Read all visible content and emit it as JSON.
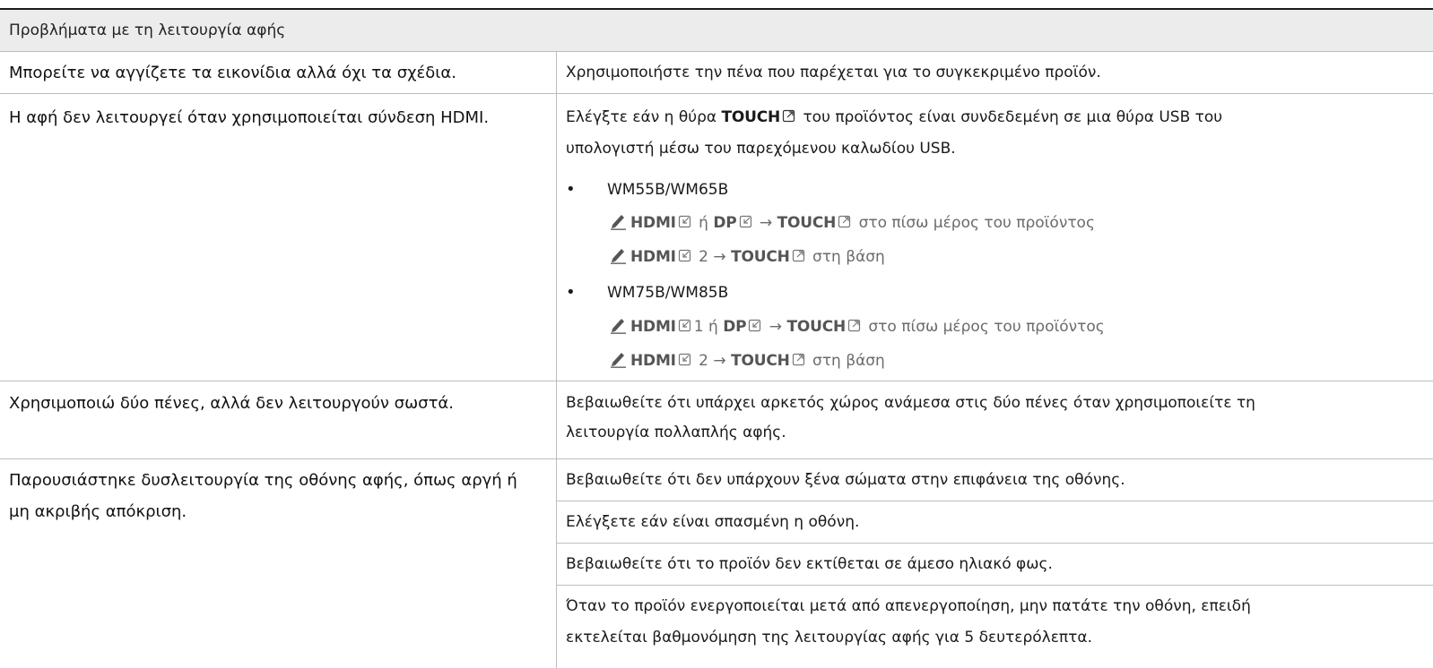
{
  "table": {
    "header": "Προβλήματα με τη λειτουργία αφής",
    "rows": [
      {
        "question": "Μπορείτε να αγγίζετε τα εικονίδια αλλά όχι τα σχέδια.",
        "answer": "Χρησιμοποιήστε την πένα που παρέχεται για το συγκεκριμένο προϊόν."
      },
      {
        "question": "Η αφή δεν λειτουργεί όταν χρησιμοποιείται σύνδεση HDMI.",
        "answer": {
          "intro_pre": "Ελέγξτε εάν η θύρα ",
          "intro_port": "TOUCH",
          "intro_post": " του προϊόντος είναι συνδεδεμένη σε μια θύρα USB του",
          "intro_line2": "υπολογιστή μέσω του παρεχόμενου καλωδίου USB.",
          "bullet_char": "•",
          "groups": [
            {
              "model": "WM55B/WM65B",
              "notes": [
                {
                  "p1": "HDMI",
                  "p1_suffix": "",
                  "mid": " ή ",
                  "p2": "DP",
                  "arrow": " → ",
                  "p3": "TOUCH",
                  "tail": " στο πίσω μέρος του προϊόντος"
                },
                {
                  "p1": "HDMI",
                  "p1_suffix": " 2",
                  "arrow": " → ",
                  "p3": "TOUCH",
                  "tail": " στη βάση"
                }
              ]
            },
            {
              "model": "WM75B/WM85B",
              "notes": [
                {
                  "p1": "HDMI",
                  "p1_suffix": "1",
                  "mid": " ή ",
                  "p2": "DP",
                  "arrow": " → ",
                  "p3": "TOUCH",
                  "tail": " στο πίσω μέρος του προϊόντος"
                },
                {
                  "p1": "HDMI",
                  "p1_suffix": " 2",
                  "arrow": " → ",
                  "p3": "TOUCH",
                  "tail": " στη βάση"
                }
              ]
            }
          ]
        }
      },
      {
        "question": "Χρησιμοποιώ δύο πένες, αλλά δεν λειτουργούν σωστά.",
        "answer_line1": "Βεβαιωθείτε ότι υπάρχει αρκετός χώρος ανάμεσα στις δύο πένες όταν χρησιμοποιείτε τη",
        "answer_line2": "λειτουργία πολλαπλής αφής."
      },
      {
        "question": "Παρουσιάστηκε δυσλειτουργία της οθόνης αφής, όπως αργή ή μη ακριβής απόκριση.",
        "answers": [
          "Βεβαιωθείτε ότι δεν υπάρχουν ξένα σώματα στην επιφάνεια της οθόνης.",
          "Ελέγξετε εάν είναι σπασμένη η οθόνη.",
          "Βεβαιωθείτε ότι το προϊόν δεν εκτίθεται σε άμεσο ηλιακό φως."
        ],
        "answer_last_line1": "Όταν το προϊόν ενεργοποιείται μετά από απενεργοποίηση, μην πατάτε την οθόνη, επειδή",
        "answer_last_line2": "εκτελείται βαθμονόμηση της λειτουργίας αφής για 5 δευτερόλεπτα."
      }
    ]
  },
  "icons": {
    "note": "pencil-note-icon",
    "port_in": "input-port-icon",
    "port_out": "output-port-icon"
  },
  "colors": {
    "header_bg": "#ececec",
    "rule": "#1a1a1a",
    "grid": "#bdbdbd",
    "note_text": "#6b6b6b"
  }
}
